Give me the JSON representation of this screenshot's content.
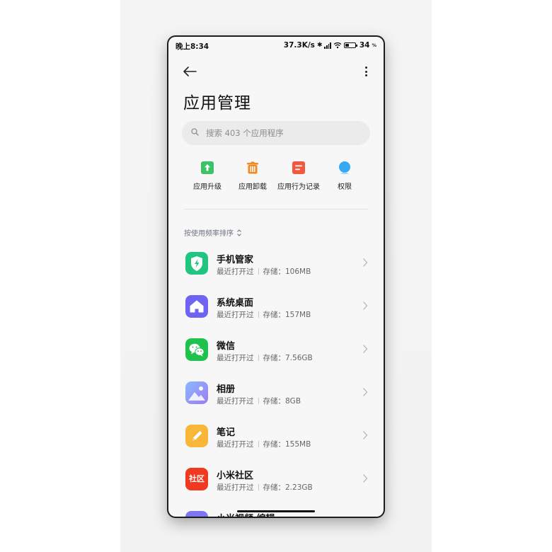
{
  "status_bar": {
    "time": "晚上8:34",
    "speed": "37.3K/s",
    "battery": "34",
    "battery_unit": "%"
  },
  "header": {
    "title": "应用管理"
  },
  "search": {
    "placeholder": "搜索 403 个应用程序"
  },
  "quick_actions": [
    {
      "label": "应用升级",
      "icon": "upgrade-icon",
      "color": "#3cc368"
    },
    {
      "label": "应用卸载",
      "icon": "trash-icon",
      "color": "#f08a24"
    },
    {
      "label": "应用行为记录",
      "icon": "record-icon",
      "color": "#f2583e"
    },
    {
      "label": "权限",
      "icon": "permission-icon",
      "color": "#36a9f2"
    }
  ],
  "sort": {
    "label": "按使用频率排序"
  },
  "apps": [
    {
      "name": "手机管家",
      "opened": "最近打开过",
      "storage": "存储：106MB",
      "icon": "security-shield-icon",
      "color": "#20c580"
    },
    {
      "name": "系统桌面",
      "opened": "最近打开过",
      "storage": "存储：157MB",
      "icon": "home-icon",
      "color": "#6f63f3"
    },
    {
      "name": "微信",
      "opened": "最近打开过",
      "storage": "存储：7.56GB",
      "icon": "wechat-icon",
      "color": "#1fc24d"
    },
    {
      "name": "相册",
      "opened": "最近打开过",
      "storage": "存储：8GB",
      "icon": "gallery-icon",
      "color": "#7fa0f5"
    },
    {
      "name": "笔记",
      "opened": "最近打开过",
      "storage": "存储：155MB",
      "icon": "notes-pencil-icon",
      "color": "#f8b738"
    },
    {
      "name": "小米社区",
      "opened": "最近打开过",
      "storage": "存储：2.23GB",
      "icon": "community-icon",
      "color": "#f0391f",
      "icon_text": "社区"
    },
    {
      "name": "小米视频 编辑",
      "opened": "",
      "storage": "",
      "icon": "video-icon",
      "color": "#7d76f0"
    }
  ]
}
